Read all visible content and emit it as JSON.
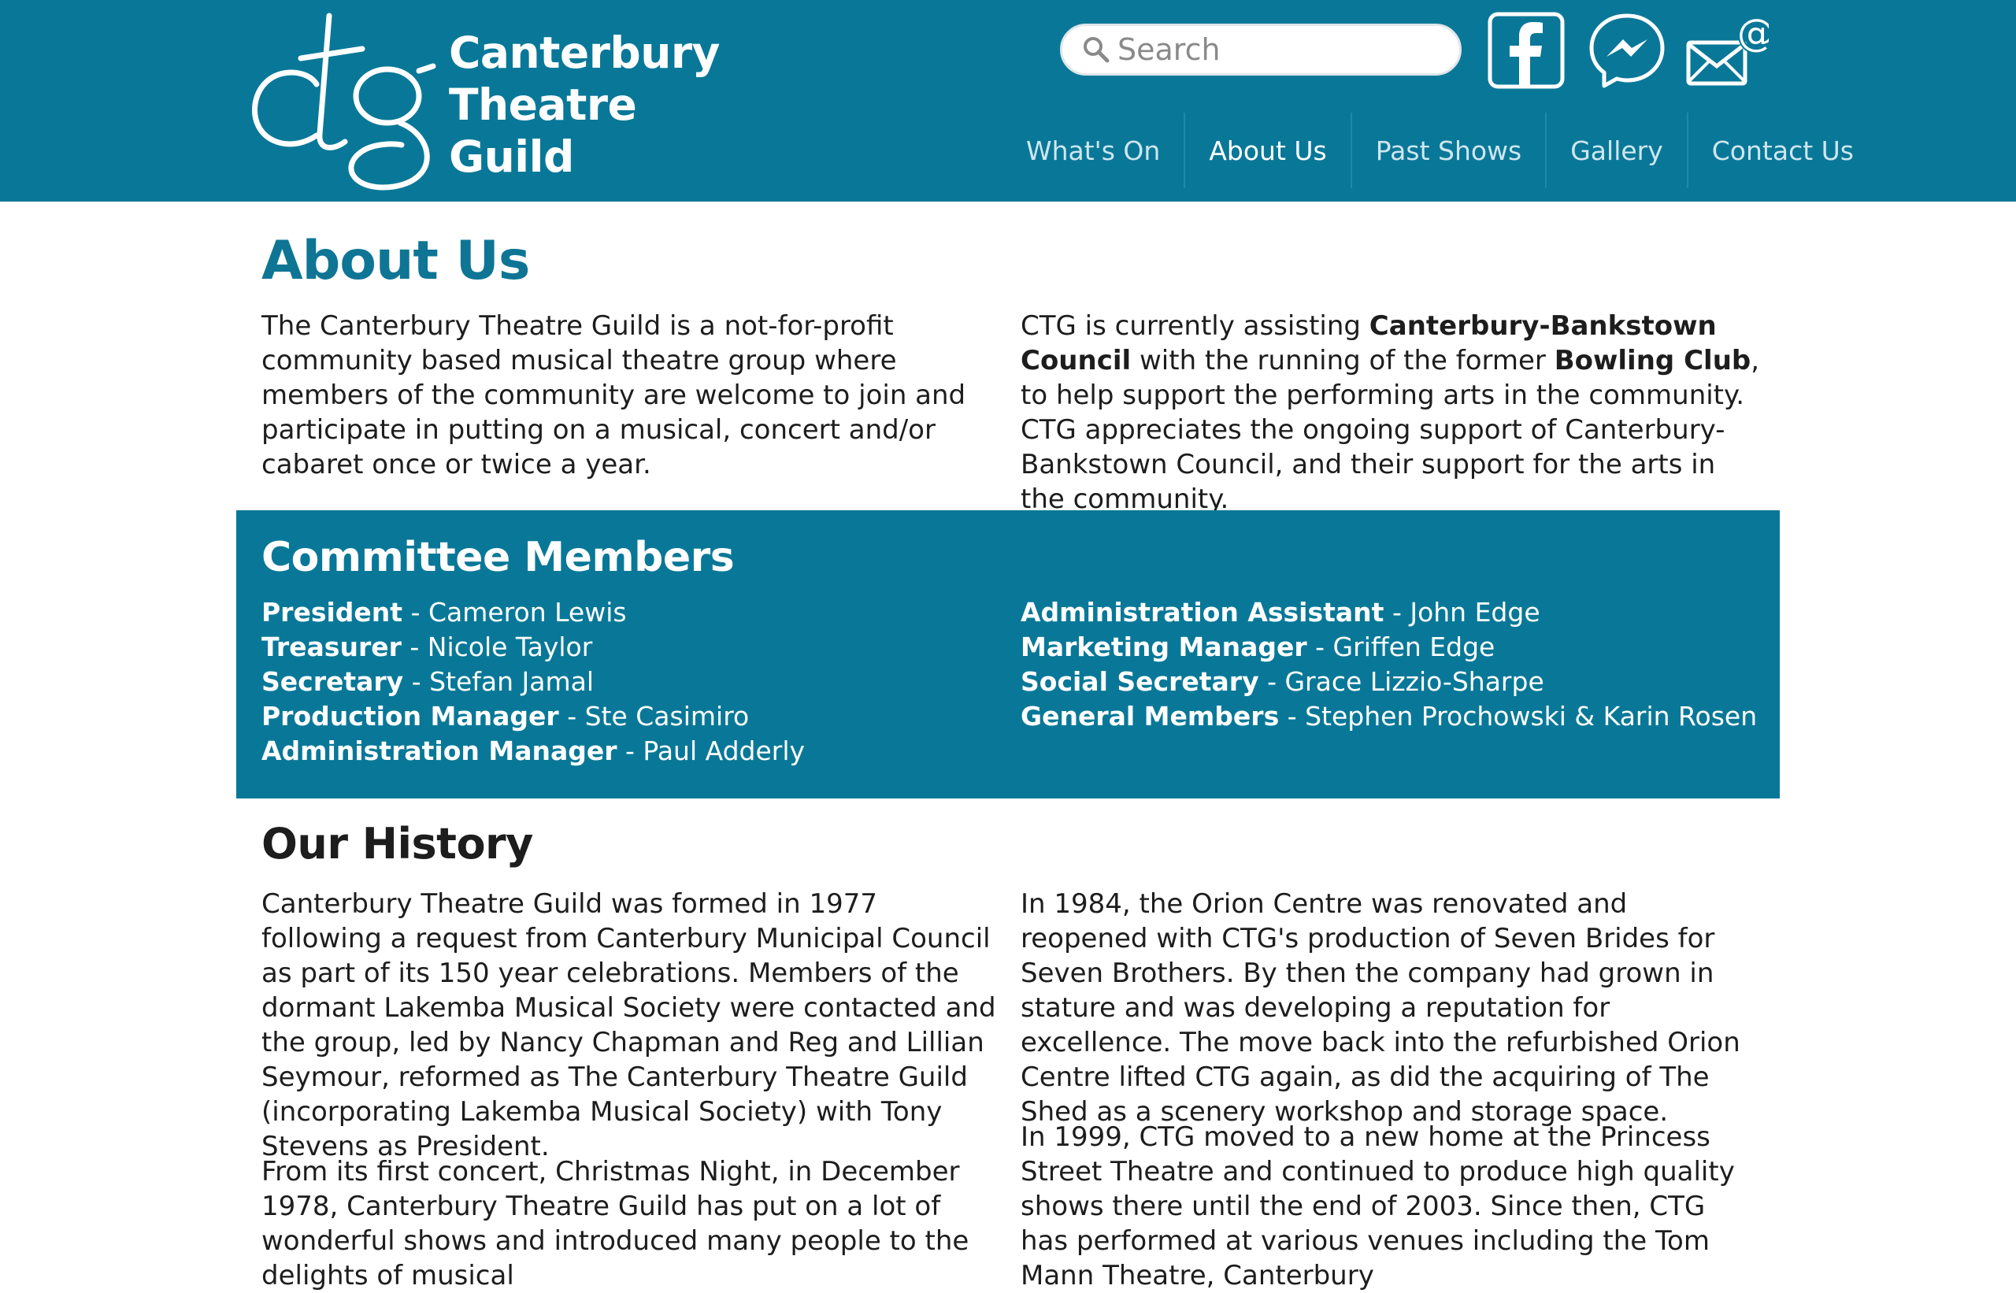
{
  "brand": {
    "logo_mark": "ctg",
    "name_lines": [
      "Canterbury",
      "Theatre",
      "Guild"
    ],
    "header_color": "#097898",
    "accent_color": "#0e7595"
  },
  "search": {
    "placeholder": "Search",
    "icon": "search-icon"
  },
  "social": [
    {
      "name": "facebook",
      "icon": "facebook-icon"
    },
    {
      "name": "messenger",
      "icon": "messenger-icon"
    },
    {
      "name": "email",
      "icon": "email-icon"
    }
  ],
  "nav": {
    "items": [
      {
        "label": "What's On",
        "active": false
      },
      {
        "label": "About Us",
        "active": true
      },
      {
        "label": "Past Shows",
        "active": false
      },
      {
        "label": "Gallery",
        "active": false
      },
      {
        "label": "Contact Us",
        "active": false
      }
    ]
  },
  "about": {
    "title": "About Us",
    "left_text": "The Canterbury Theatre Guild is a not-for-profit community based musical theatre group where members of the community are welcome to join and participate in putting on a musical, concert and/or cabaret once or twice a year.",
    "right_text": {
      "part1": "CTG is currently assisting ",
      "bold1": "Canterbury-Bankstown Council",
      "part2": " with the running of the former ",
      "bold2": "Bowling Club",
      "part3": ", to help support the performing arts in the community. CTG appreciates the ongoing support of Canterbury-Bankstown Council, and their support for the arts in the community."
    }
  },
  "committee": {
    "title": "Committee Members",
    "left": [
      {
        "role": "President",
        "name": " - Cameron Lewis"
      },
      {
        "role": "Treasurer",
        "name": " - Nicole Taylor"
      },
      {
        "role": "Secretary",
        "name": " - Stefan Jamal"
      },
      {
        "role": "Production Manager",
        "name": " - Ste Casimiro"
      },
      {
        "role": "Administration Manager",
        "name": " - Paul Adderly"
      }
    ],
    "right": [
      {
        "role": "Administration Assistant",
        "name": " - John Edge"
      },
      {
        "role": "Marketing Manager",
        "name": " - Griffen Edge"
      },
      {
        "role": "Social Secretary",
        "name": " - Grace Lizzio-Sharpe"
      },
      {
        "role": "General Members",
        "name": " - Stephen Prochowski & Karin Rosen"
      }
    ]
  },
  "history": {
    "title": "Our History",
    "left_p1": "Canterbury Theatre Guild was formed in 1977 following a request from Canterbury Municipal Council as part of its 150 year celebrations. Members of the dormant Lakemba Musical Society were contacted and the group, led by Nancy Chapman and Reg and Lillian Seymour, reformed as The Canterbury Theatre Guild (incorporating Lakemba Musical Society) with Tony Stevens as President.",
    "left_p2": "From its first concert, Christmas Night, in December 1978, Canterbury Theatre Guild has put on a lot of wonderful shows and introduced many people to the delights of musical",
    "right_p1": "In 1984, the Orion Centre was renovated and reopened with CTG's production of Seven Brides for Seven Brothers. By then the company had grown in stature and was developing a reputation for excellence. The move back into the refurbished Orion Centre lifted CTG again, as did the acquiring of The Shed as a scenery workshop and storage space.",
    "right_p2": "In 1999, CTG moved to a new home at the Princess Street Theatre and continued to produce high quality shows there until the end of 2003. Since then, CTG has performed at various venues including the Tom Mann Theatre, Canterbury"
  }
}
